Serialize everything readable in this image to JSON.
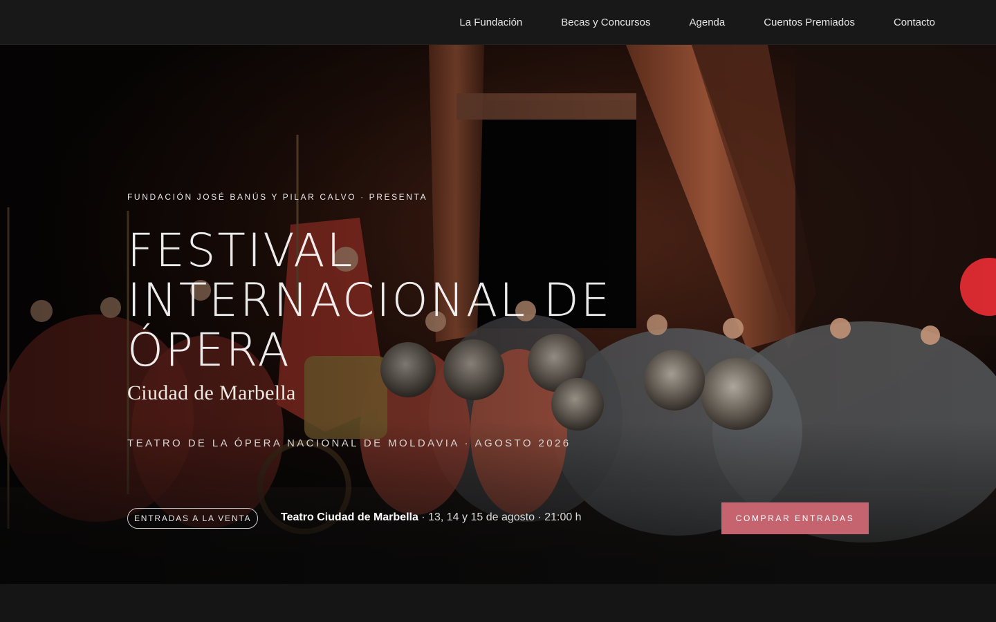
{
  "nav": {
    "items": [
      {
        "label": "La Fundación"
      },
      {
        "label": "Becas y Concursos"
      },
      {
        "label": "Agenda"
      },
      {
        "label": "Cuentos Premiados"
      },
      {
        "label": "Contacto"
      }
    ]
  },
  "hero": {
    "eyebrow": "Fundación José Banús y Pilar Calvo · Presenta",
    "title_lines": [
      "Festival",
      "Internacional de",
      "Ópera"
    ],
    "subtitle": "Ciudad de Marbella",
    "venue_line": "Teatro de la Ópera Nacional de Moldavia · Agosto 2026",
    "badge": "Entradas a la venta",
    "event_venue": "Teatro Ciudad de Marbella",
    "event_details": " · 13, 14 y 15 de agosto · 21:00 h",
    "cta_label": "Comprar entradas"
  },
  "colors": {
    "accent": "#c5636f",
    "topbar": "#181818",
    "page_background": "#151515"
  }
}
